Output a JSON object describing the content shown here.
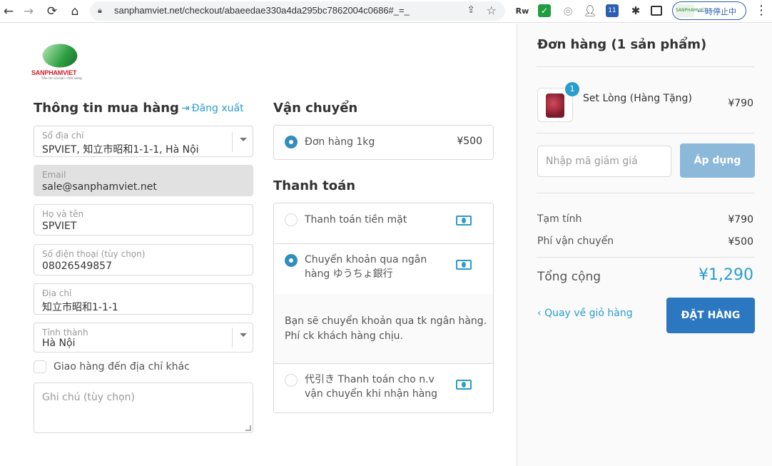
{
  "browser": {
    "url": "sanphamviet.net/checkout/abaeedae330a4da295bc7862004c0686#_=_",
    "pause_label": "一時停止中",
    "pause_avatar_text": "SANPHAMVIET"
  },
  "store": {
    "brand": "SANPHAMVIET",
    "tagline": "Tiêu chí của bạn: chất lượng"
  },
  "customer": {
    "section_title": "Thông tin mua hàng",
    "logout_label": "Đăng xuất",
    "address_book": {
      "label": "Sổ địa chỉ",
      "value": "SPVIET, 知立市昭和1-1-1, Hà Nội"
    },
    "email": {
      "label": "Email",
      "value": "sale@sanphamviet.net"
    },
    "full_name": {
      "label": "Họ và tên",
      "value": "SPVIET"
    },
    "phone": {
      "label": "Số điện thoại (tùy chọn)",
      "value": "08026549857"
    },
    "address": {
      "label": "Địa chỉ",
      "value": "知立市昭和1-1-1"
    },
    "province": {
      "label": "Tỉnh thành",
      "value": "Hà Nội"
    },
    "ship_other_label": "Giao hàng đến địa chỉ khác",
    "note_placeholder": "Ghi chú (tùy chọn)"
  },
  "shipping": {
    "section_title": "Vận chuyển",
    "options": [
      {
        "label": "Đơn hàng 1kg",
        "price": "¥500",
        "selected": true
      }
    ]
  },
  "payment": {
    "section_title": "Thanh toán",
    "methods": [
      {
        "label": "Thanh toán tiền mặt",
        "selected": false
      },
      {
        "label": "Chuyển khoản qua ngân hàng ゆうちょ銀行",
        "selected": true
      },
      {
        "label": "代引き Thanh toán cho n.v vận chuyển khi nhận hàng",
        "selected": false
      }
    ],
    "bank_note": "Bạn sẽ chuyển khoản qua tk ngân hàng. Phí ck khách hàng chịu."
  },
  "summary": {
    "title": "Đơn hàng (1 sản phẩm)",
    "item": {
      "name": "Set Lòng (Hàng Tặng)",
      "qty": "1",
      "price": "¥790"
    },
    "coupon_placeholder": "Nhập mã giảm giá",
    "apply_label": "Áp dụng",
    "subtotal_label": "Tạm tính",
    "subtotal": "¥790",
    "shipping_label": "Phí vận chuyển",
    "shipping": "¥500",
    "total_label": "Tổng cộng",
    "total": "¥1,290",
    "back_label": "Quay về giỏ hàng",
    "place_order_label": "ĐẶT HÀNG"
  },
  "colors": {
    "accent": "#2a9dcc",
    "button": "#2b77c0",
    "apply_disabled": "#8cb8d9"
  }
}
